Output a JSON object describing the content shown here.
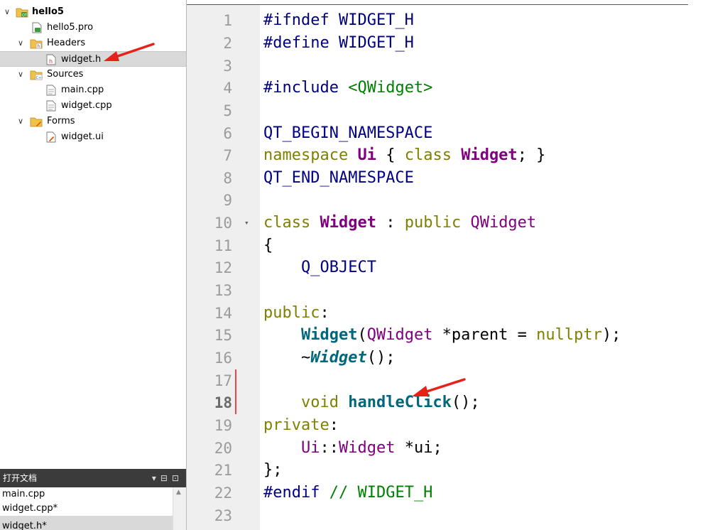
{
  "project_tree": {
    "items": [
      {
        "label": "hello5",
        "level": 0,
        "expanded": true,
        "icon": "project-folder-icon",
        "bold": true
      },
      {
        "label": "hello5.pro",
        "level": 1,
        "icon": "pro-file-icon"
      },
      {
        "label": "Headers",
        "level": 1,
        "expanded": true,
        "icon": "headers-folder-icon"
      },
      {
        "label": "widget.h",
        "level": 2,
        "icon": "header-file-icon",
        "selected": true
      },
      {
        "label": "Sources",
        "level": 1,
        "expanded": true,
        "icon": "sources-folder-icon"
      },
      {
        "label": "main.cpp",
        "level": 2,
        "icon": "source-file-icon"
      },
      {
        "label": "widget.cpp",
        "level": 2,
        "icon": "source-file-icon"
      },
      {
        "label": "Forms",
        "level": 1,
        "expanded": true,
        "icon": "forms-folder-icon"
      },
      {
        "label": "widget.ui",
        "level": 2,
        "icon": "ui-file-icon"
      }
    ]
  },
  "open_documents": {
    "title": "打开文档",
    "docs": [
      "main.cpp",
      "widget.cpp*",
      "widget.h*"
    ]
  },
  "editor": {
    "current_line": 18,
    "lines": [
      {
        "n": "1",
        "text": "#ifndef WIDGET_H"
      },
      {
        "n": "2",
        "text": "#define WIDGET_H"
      },
      {
        "n": "3",
        "text": ""
      },
      {
        "n": "4",
        "text": "#include <QWidget>"
      },
      {
        "n": "5",
        "text": ""
      },
      {
        "n": "6",
        "text": "QT_BEGIN_NAMESPACE"
      },
      {
        "n": "7",
        "text": "namespace Ui { class Widget; }"
      },
      {
        "n": "8",
        "text": "QT_END_NAMESPACE"
      },
      {
        "n": "9",
        "text": ""
      },
      {
        "n": "10",
        "text": "class Widget : public QWidget"
      },
      {
        "n": "11",
        "text": "{"
      },
      {
        "n": "12",
        "text": "    Q_OBJECT"
      },
      {
        "n": "13",
        "text": ""
      },
      {
        "n": "14",
        "text": "public:"
      },
      {
        "n": "15",
        "text": "    Widget(QWidget *parent = nullptr);"
      },
      {
        "n": "16",
        "text": "    ~Widget();"
      },
      {
        "n": "17",
        "text": ""
      },
      {
        "n": "18",
        "text": "    void handleClick();"
      },
      {
        "n": "19",
        "text": "private:"
      },
      {
        "n": "20",
        "text": "    Ui::Widget *ui;"
      },
      {
        "n": "21",
        "text": "};"
      },
      {
        "n": "22",
        "text": "#endif // WIDGET_H"
      },
      {
        "n": "23",
        "text": ""
      }
    ]
  },
  "colors": {
    "annotation_arrow": "#e8201a",
    "change_marker": "#e84848"
  }
}
